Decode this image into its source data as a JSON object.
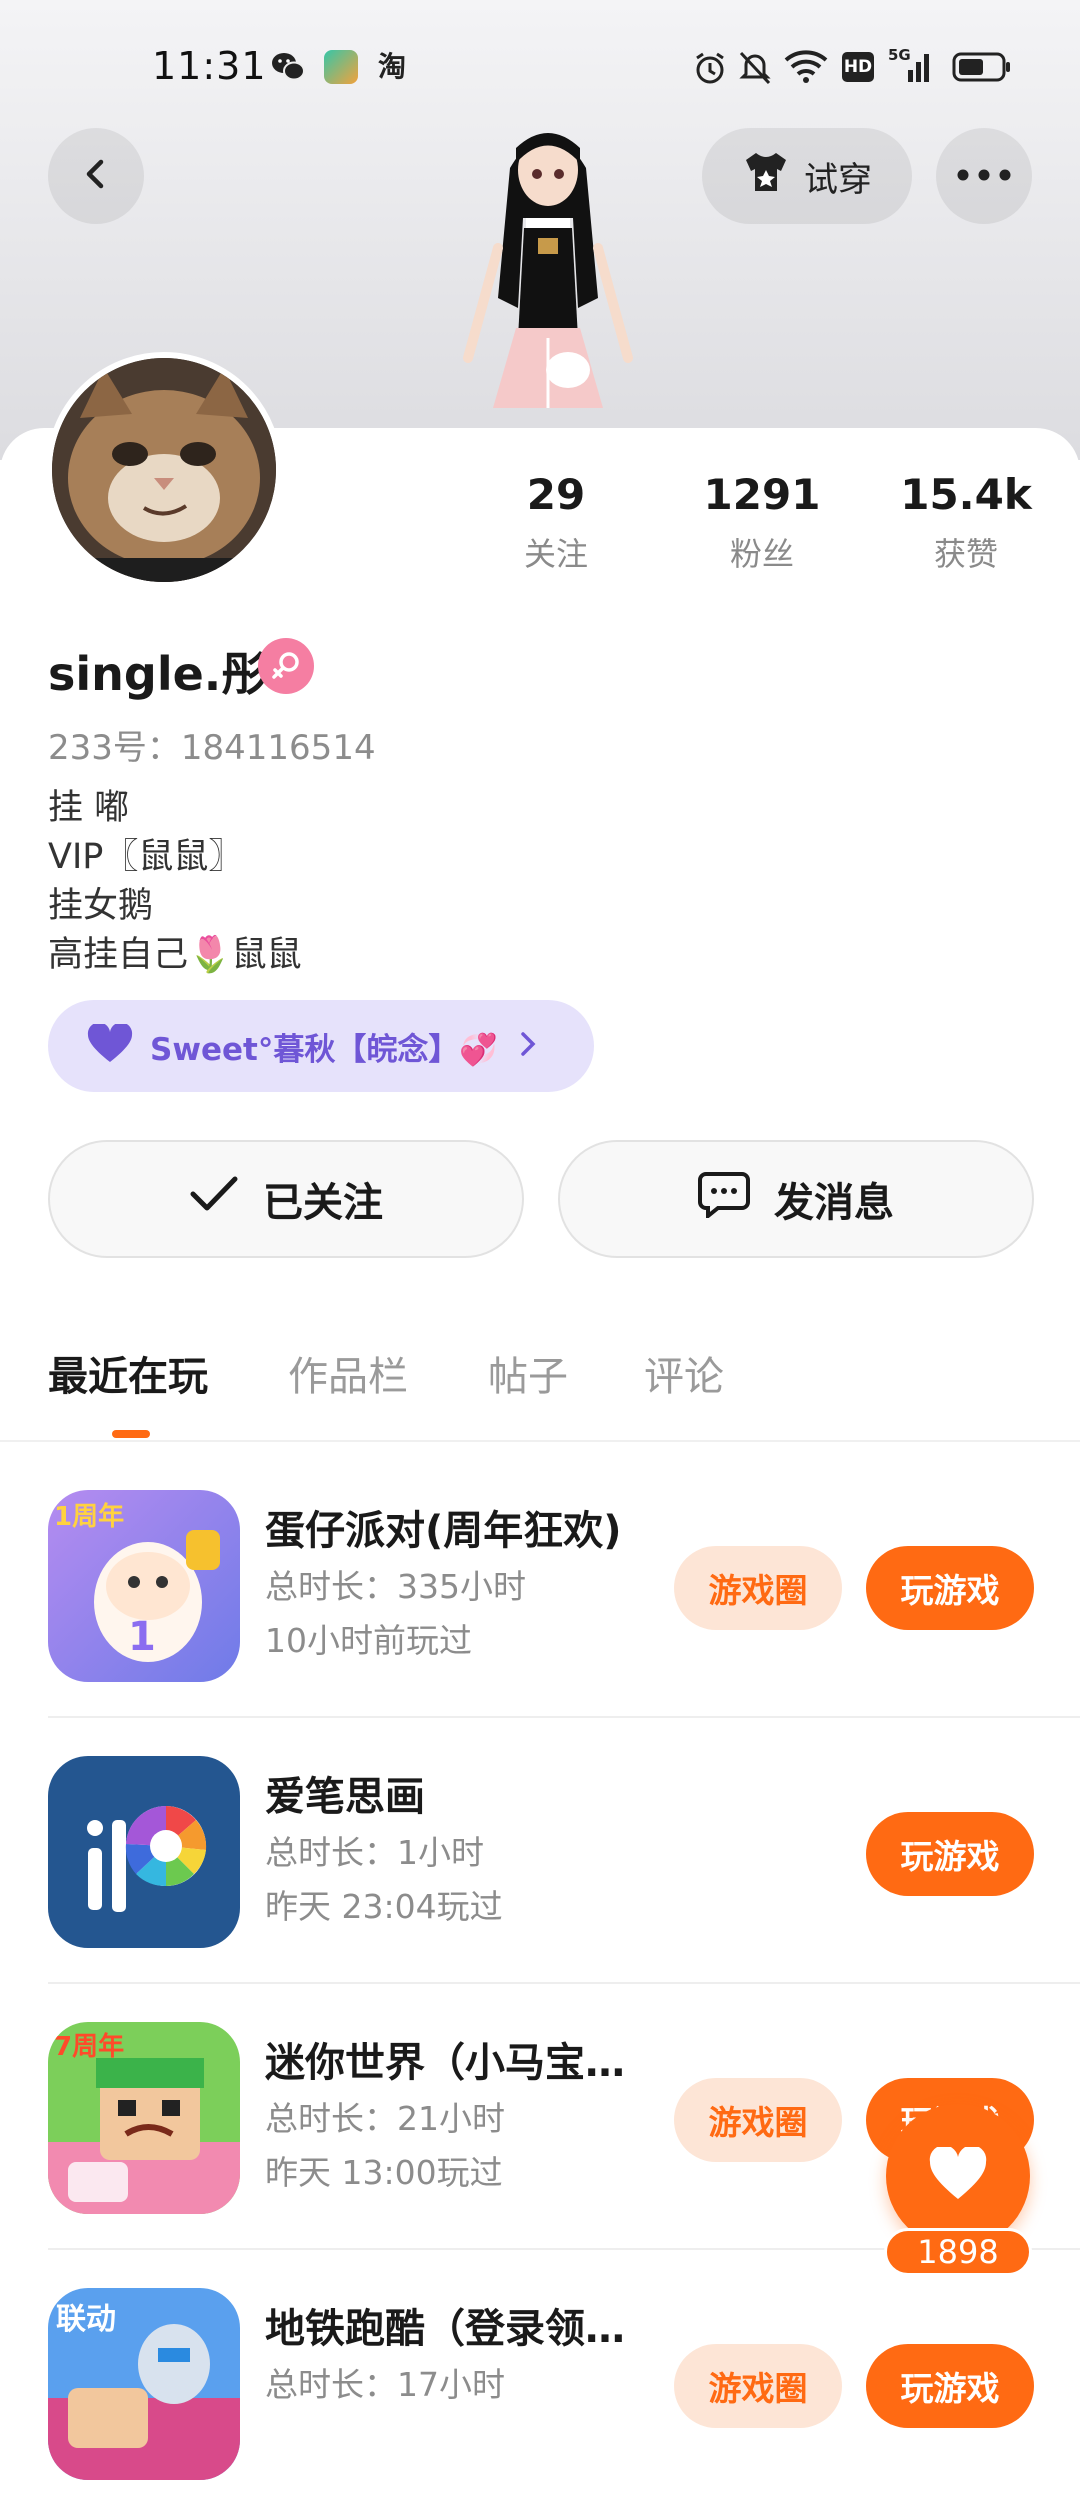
{
  "status_bar": {
    "time": "11:31",
    "app_icons": [
      "wechat-icon",
      "assistant-app-icon",
      "taobao-icon"
    ],
    "taobao_glyph": "淘",
    "right_icons": [
      "alarm-icon",
      "mute-icon",
      "wifi-icon",
      "hd-icon",
      "5g-signal-icon",
      "battery-icon"
    ],
    "hd_label": "HD",
    "net_label": "5G"
  },
  "header": {
    "back_icon": "chevron-left-icon",
    "try_on_label": "试穿",
    "more_icon": "more-icon"
  },
  "profile": {
    "stats": [
      {
        "value": "29",
        "label": "关注"
      },
      {
        "value": "1291",
        "label": "粉丝"
      },
      {
        "value": "15.4k",
        "label": "获赞"
      }
    ],
    "name": "single.彤",
    "gender_icon": "female-icon",
    "uid": "233号：184116514",
    "bio": [
      "挂 嘟",
      "VIP〖鼠鼠〗",
      "挂女鹅",
      "高挂自己🌷鼠鼠"
    ],
    "group_label": "Sweet°暮秋【皖念】💞",
    "followed_label": "已关注",
    "message_label": "发消息"
  },
  "tabs": [
    {
      "label": "最近在玩",
      "active": true
    },
    {
      "label": "作品栏",
      "active": false
    },
    {
      "label": "帖子",
      "active": false
    },
    {
      "label": "评论",
      "active": false
    }
  ],
  "games": [
    {
      "title": "蛋仔派对(周年狂欢)",
      "duration": "总时长：335小时",
      "last_played": "10小时前玩过",
      "circle_label": "游戏圈",
      "play_label": "玩游戏",
      "icon_badge": "1周年"
    },
    {
      "title": "爱笔思画",
      "duration": "总时长：1小时",
      "last_played": "昨天 23:04玩过",
      "circle_label": "",
      "play_label": "玩游戏",
      "icon_badge": ""
    },
    {
      "title": "迷你世界（小马宝…",
      "duration": "总时长：21小时",
      "last_played": "昨天 13:00玩过",
      "circle_label": "游戏圈",
      "play_label": "玩游戏",
      "icon_badge": "7周年"
    },
    {
      "title": "地铁跑酷（登录领…",
      "duration": "总时长：17小时",
      "last_played": "",
      "circle_label": "游戏圈",
      "play_label": "玩游戏",
      "icon_badge": "联动"
    }
  ],
  "like_float": {
    "count": "1898",
    "icon": "heart-icon"
  }
}
